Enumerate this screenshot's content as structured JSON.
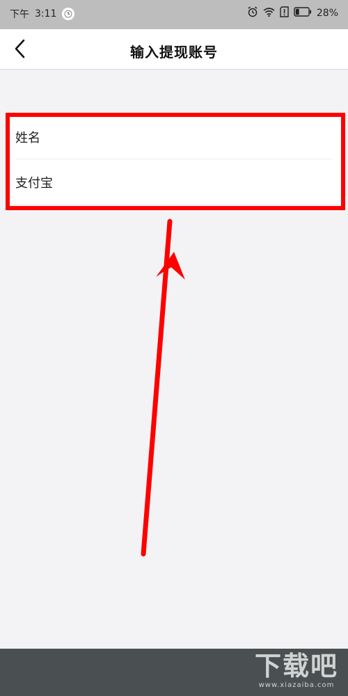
{
  "status_bar": {
    "period": "下午",
    "time": "3:11",
    "battery_percent": "28%",
    "battery_level": 0.28,
    "icons": [
      "alarm-icon",
      "wifi-icon",
      "sim-alert-icon",
      "battery-icon"
    ]
  },
  "nav": {
    "title": "输入提现账号",
    "back_icon": "chevron-left-icon"
  },
  "form": {
    "rows": [
      {
        "label": "姓名"
      },
      {
        "label": "支付宝"
      }
    ]
  },
  "annotation": {
    "highlight_color": "#ff0000",
    "arrow_color": "#ff0000"
  },
  "watermark": {
    "main": "下载吧",
    "sub": "www.xiazaiba.com"
  },
  "colors": {
    "status_bg": "#bdbdbd",
    "nav_bg": "#ffffff",
    "page_bg": "#f3f3f5",
    "bottom_band": "#4a4f52"
  }
}
